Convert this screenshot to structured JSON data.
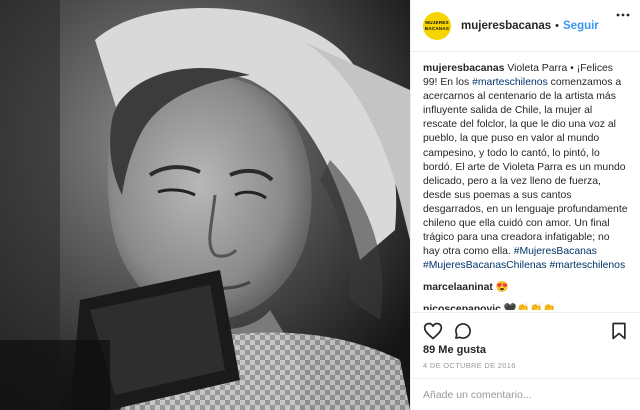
{
  "post": {
    "image_alt": "Black and white photo of a woman with a headscarf",
    "author": {
      "username": "mujeresbacanas",
      "avatar_line1": "MUJERES",
      "avatar_line2": "BACANAS"
    },
    "separator": "•",
    "follow_label": "Seguir",
    "caption": {
      "username": "mujeresbacanas",
      "text_part1": " Violeta Parra • ¡Felices 99! En los ",
      "hashtag1": "#marteschilenos",
      "text_part2": " comenzamos a acercarnos al centenario de la artista más influyente salida de Chile, la mujer al rescate del folclor, la que le dio una voz al pueblo, la que puso en valor al mundo campesino, y todo lo cantó, lo pintó, lo bordó. El arte de Violeta Parra es un mundo delicado, pero a la vez lleno de fuerza, desde sus poemas a sus cantos desgarrados, en un lenguaje profundamente chileno que ella cuidó con amor. Un final trágico para una creadora infatigable; no hay otra como ella. ",
      "hashtag2": "#MujeresBacanas",
      "hashtag3": "#MujeresBacanasChilenas",
      "hashtag4": "#marteschilenos"
    },
    "comments": [
      {
        "username": "marcelaaninat",
        "text": "😍"
      },
      {
        "username": "nicoscepanovic",
        "text": "🖤👏👏👏"
      }
    ],
    "actions": {
      "like_icon": "heart-icon",
      "comment_icon": "comment-icon",
      "save_icon": "bookmark-icon"
    },
    "likes_text": "89 Me gusta",
    "date_text": "4 DE OCTUBRE DE 2016",
    "comment_placeholder": "Añade un comentario...",
    "more_icon": "more-options-icon"
  }
}
